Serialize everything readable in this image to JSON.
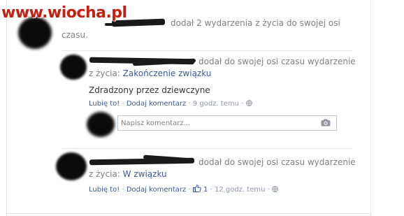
{
  "watermark": "www.wiocha.pl",
  "top_post": {
    "text_line1": "dodał 2 wydarzenia z życia do swojej osi",
    "text_line2": "czasu."
  },
  "events": [
    {
      "text_line1": "dodał do swojej osi czasu wydarzenie",
      "prefix": "z życia:",
      "event_link": "Zakończenie związku",
      "body": "Zdradzony przez dziewczyne",
      "like": "Lubię to!",
      "comment": "Dodaj komentarz",
      "time": "9 godz. temu"
    },
    {
      "text_line1": "dodał do swojej osi czasu wydarzenie",
      "prefix": "z życia:",
      "event_link": "W związku",
      "like": "Lubię to!",
      "comment": "Dodaj komentarz",
      "like_count": "1",
      "time": "12 godz. temu"
    }
  ],
  "comment_box": {
    "placeholder": "Napisz komentarz..."
  },
  "separator": "·",
  "colors": {
    "link": "#3b5998",
    "watermark": "#c51f10",
    "meta": "#8f96a8"
  },
  "icons": [
    "globe-icon",
    "camera-icon",
    "thumbs-up-icon"
  ]
}
